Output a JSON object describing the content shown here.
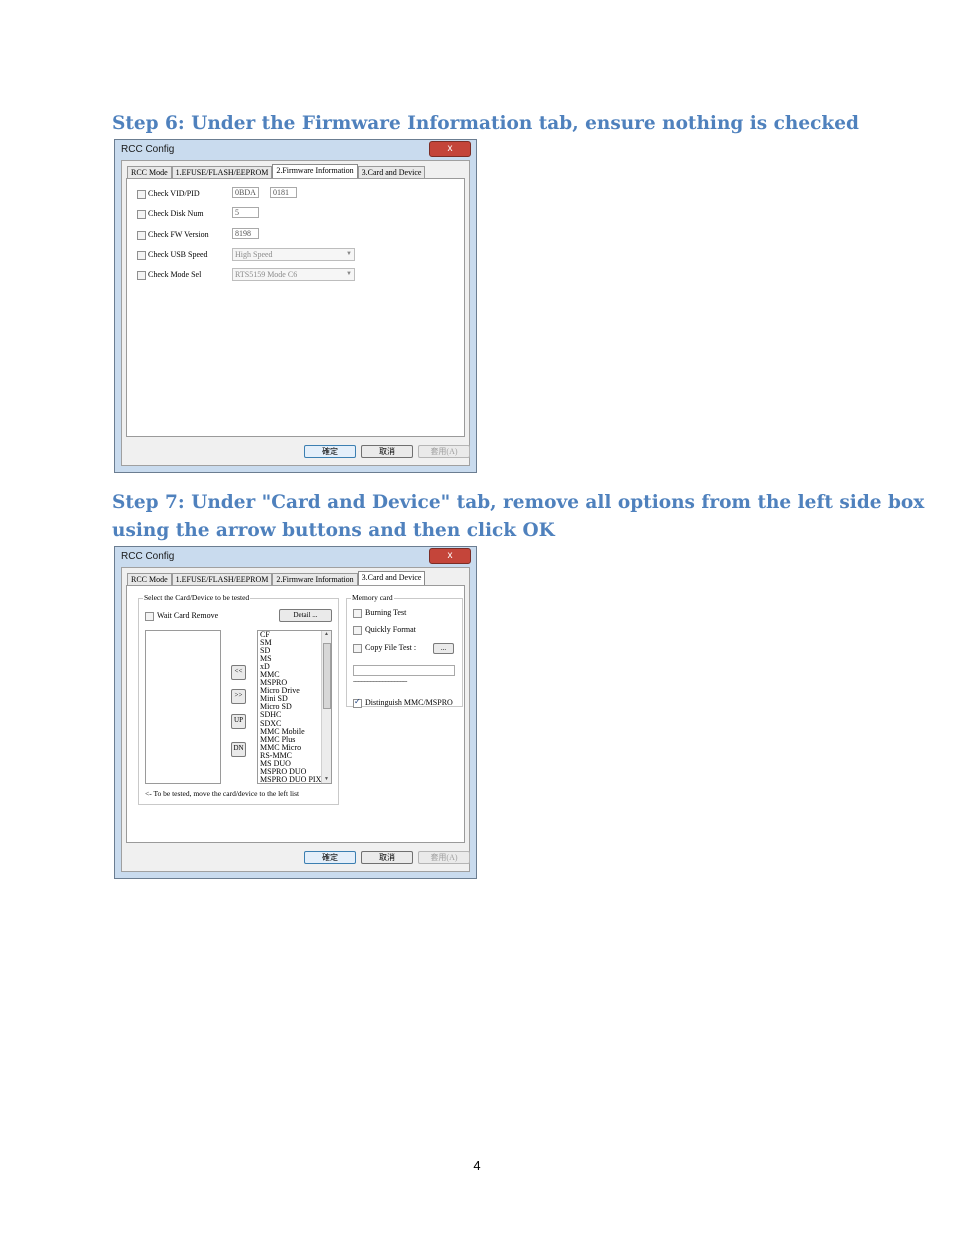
{
  "step6": {
    "heading": "Step 6:  Under the Firmware Information tab, ensure nothing is checked",
    "window": {
      "title": "RCC Config",
      "close_label": "x",
      "tabs": [
        "RCC Mode",
        "1.EFUSE/FLASH/EEPROM",
        "2.Firmware Information",
        "3.Card and Device"
      ],
      "active_tab": "2.Firmware Information",
      "rows": [
        {
          "label": "Check VID/PID",
          "checked": false,
          "value1": "0BDA",
          "value2": "0181"
        },
        {
          "label": "Check Disk Num",
          "checked": false,
          "value1": "5"
        },
        {
          "label": "Check FW Version",
          "checked": false,
          "value1": "8198"
        },
        {
          "label": "Check USB Speed",
          "checked": false,
          "select": "High Speed"
        },
        {
          "label": "Check Mode Sel",
          "checked": false,
          "select": "RTS5159 Mode C6"
        }
      ],
      "buttons": {
        "ok": "確定",
        "cancel": "取消",
        "apply": "套用(A)"
      }
    }
  },
  "step7": {
    "heading_line1": "Step 7: Under \"Card and Device\" tab, remove all options from the left side box",
    "heading_line2": "using the arrow buttons and then click OK",
    "window": {
      "title": "RCC Config",
      "close_label": "x",
      "tabs": [
        "RCC Mode",
        "1.EFUSE/FLASH/EEPROM",
        "2.Firmware Information",
        "3.Card and Device"
      ],
      "active_tab": "3.Card and Device",
      "select_group": {
        "title": "Select the Card/Device to be tested",
        "wait_card_remove": "Wait Card Remove",
        "wait_card_remove_checked": false,
        "detail_button": "Detail ...",
        "left_list": [],
        "arrow_buttons": [
          "<<",
          ">>",
          "UP",
          "DN"
        ],
        "right_list": [
          "CF",
          "SM",
          "SD",
          "MS",
          "xD",
          "MMC",
          "MSPRO",
          "Micro Drive",
          "Mini SD",
          "Micro SD",
          "SDHC",
          "SDXC",
          "MMC Mobile",
          "MMC Plus",
          "MMC Micro",
          "RS-MMC",
          "MS DUO",
          "MSPRO DUO",
          "MSPRO DUO PIXC"
        ],
        "hint": "<- To be tested, move the card/device to the left list"
      },
      "memory_card": {
        "title": "Memory card",
        "burning_test": "Burning Test",
        "burning_test_checked": false,
        "quickly_format": "Quickly Format",
        "quickly_format_checked": false,
        "copy_file_test": "Copy File Test :",
        "copy_file_test_checked": false,
        "browse_button": "...",
        "file_path": "",
        "separator": "------------------------------------",
        "distinguish": "Distinguish MMC/MSPRO",
        "distinguish_checked": true
      },
      "buttons": {
        "ok": "確定",
        "cancel": "取消",
        "apply": "套用(A)"
      }
    }
  },
  "page_number": "4"
}
